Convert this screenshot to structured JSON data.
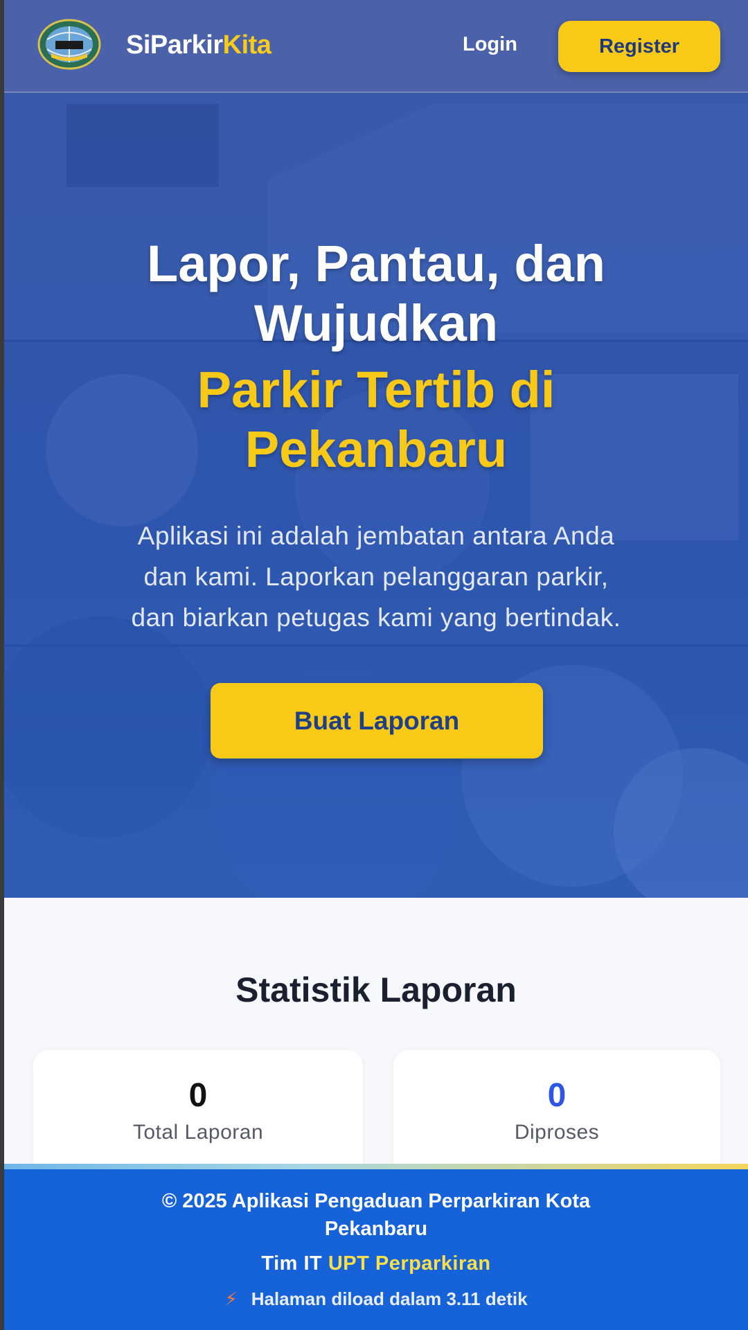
{
  "navbar": {
    "brand_main": "SiParkir",
    "brand_accent": "Kita",
    "login_label": "Login",
    "register_label": "Register",
    "logo_icon": "city-emblem-icon"
  },
  "hero": {
    "title_line1": "Lapor, Pantau, dan",
    "title_line2": "Wujudkan",
    "accent_line1": "Parkir Tertib di",
    "accent_line2": "Pekanbaru",
    "description_lines": [
      "Aplikasi ini adalah jembatan antara Anda",
      "dan kami. Laporkan pelanggaran parkir,",
      "dan biarkan petugas kami yang bertindak."
    ],
    "cta_label": "Buat Laporan"
  },
  "stats": {
    "title": "Statistik Laporan",
    "cards": [
      {
        "value": "0",
        "label": "Total Laporan",
        "color": "#111111"
      },
      {
        "value": "0",
        "label": "Diproses",
        "color": "#2f55e6"
      }
    ]
  },
  "footer": {
    "copyright_line1": "© 2025 Aplikasi Pengaduan Perparkiran Kota",
    "copyright_line2": "Pekanbaru",
    "team_prefix": "Tim IT",
    "team_name": "UPT Perparkiran",
    "load_text": "Halaman diload dalam 3.11 detik",
    "load_icon": "lightning-icon"
  },
  "colors": {
    "accent_yellow": "#f9c917",
    "primary_blue": "#1662d8",
    "nav_blue": "#4e63aa"
  }
}
